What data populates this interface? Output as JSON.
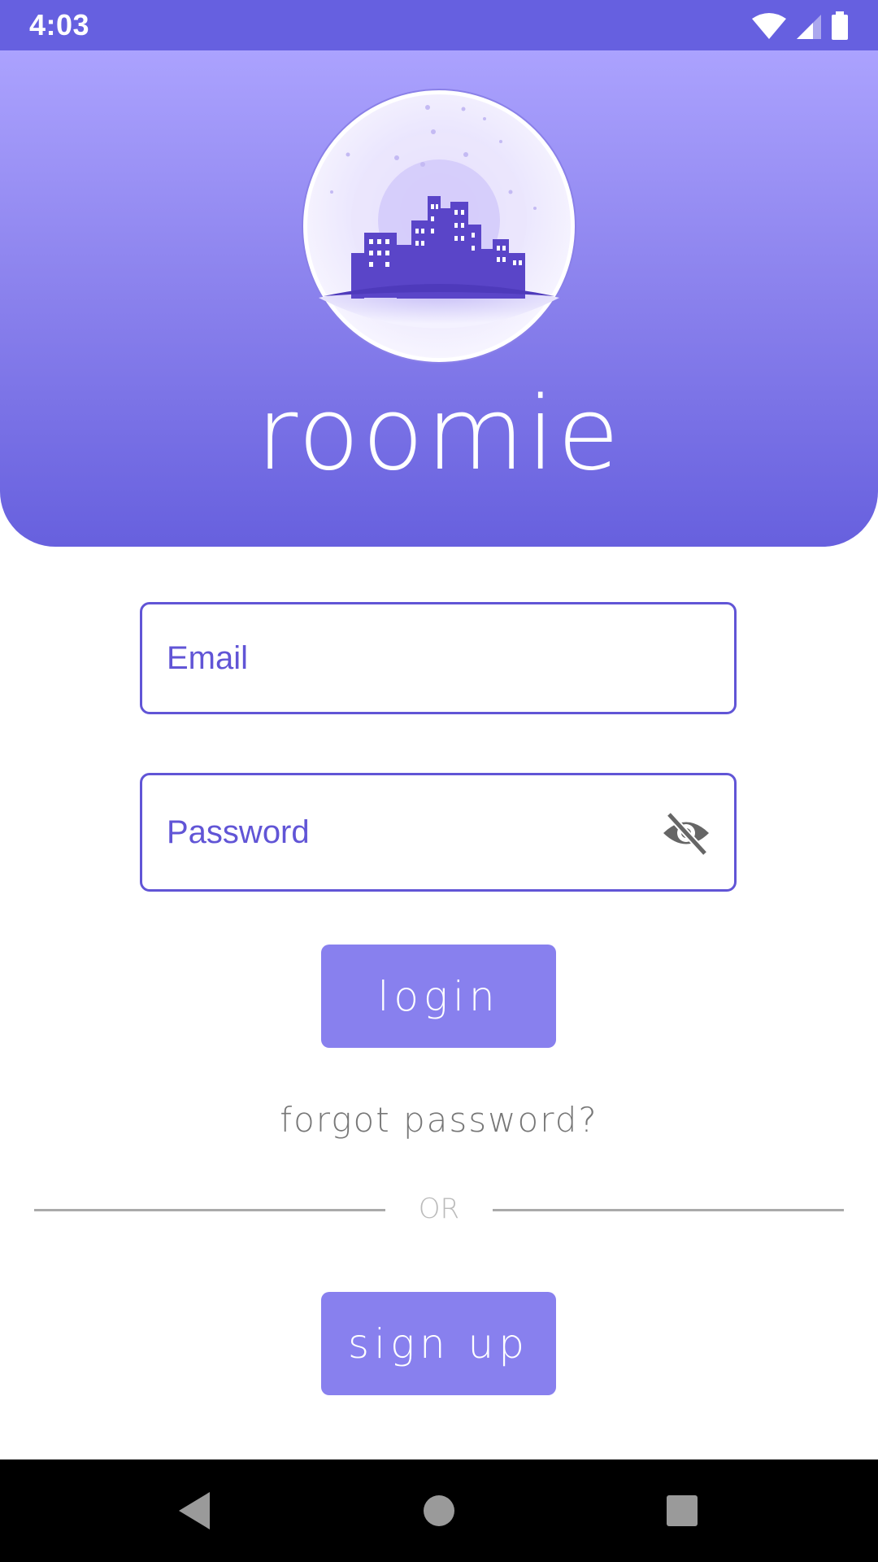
{
  "status_bar": {
    "time": "4:03"
  },
  "header": {
    "app_title": "roomie",
    "logo_icon": "city-globe-logo"
  },
  "form": {
    "email_placeholder": "Email",
    "password_placeholder": "Password",
    "login_label": "login",
    "forgot_label": "forgot password?",
    "or_label": "OR",
    "signup_label": "sign up"
  },
  "colors": {
    "accent": "#6155d6",
    "button": "#8880ee",
    "header_top": "#aba2fe",
    "header_bottom": "#6760de",
    "status_bar": "#6660e0"
  },
  "icons": {
    "password_toggle": "eye-off-icon",
    "nav_back": "back-triangle-icon",
    "nav_home": "home-circle-icon",
    "nav_recents": "recents-square-icon"
  }
}
